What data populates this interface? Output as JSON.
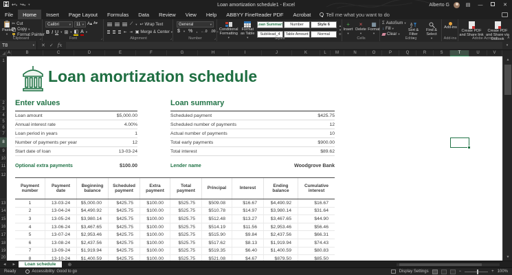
{
  "window": {
    "title": "Loan amortization schedule1  -  Excel",
    "user": "Alberto G"
  },
  "ribbon": {
    "tabs": [
      "File",
      "Home",
      "Insert",
      "Page Layout",
      "Formulas",
      "Data",
      "Review",
      "View",
      "Help",
      "ABBYY FineReader PDF",
      "Acrobat"
    ],
    "active_tab": "Home",
    "tell_me": "Tell me what you want to do",
    "clipboard": {
      "label": "Clipboard",
      "paste": "Paste",
      "cut": "Cut",
      "copy": "Copy",
      "format_painter": "Format Painter"
    },
    "font": {
      "label": "Font",
      "name": "Calibri",
      "size": "11"
    },
    "alignment": {
      "label": "Alignment",
      "wrap_text": "Wrap Text",
      "merge_center": "Merge & Center"
    },
    "number": {
      "label": "Number",
      "format": "General"
    },
    "styles": {
      "label": "Styles",
      "conditional": "Conditional Formatting",
      "format_table": "Format as Table",
      "gallery": [
        "Loan Summary",
        "Number",
        "Style 6",
        "SubHead_4",
        "Table Amount",
        "Normal"
      ]
    },
    "cells": {
      "label": "Cells",
      "buttons": [
        "Insert",
        "Delete",
        "Format"
      ]
    },
    "editing": {
      "label": "Editing",
      "autosum": "AutoSum",
      "fill": "Fill",
      "clear": "Clear",
      "sort": "Sort & Filter",
      "find": "Find & Select"
    },
    "addins": {
      "label": "Add-ins",
      "button": "Add-ins"
    },
    "acrobat": {
      "label": "Adobe Acrobat",
      "buttons": [
        "Create PDF and Share link",
        "Create PDF and Share via Outlook"
      ]
    }
  },
  "formula_bar": {
    "name_box": "T8"
  },
  "grid": {
    "columns": [
      "A",
      "B",
      "C",
      "D",
      "E",
      "F",
      "G",
      "H",
      "I",
      "J",
      "K",
      "L",
      "M",
      "N",
      "O",
      "P",
      "Q",
      "R",
      "S",
      "T",
      "U",
      "V"
    ],
    "selected_column": "T",
    "rows": [
      1,
      2,
      3,
      4,
      5,
      6,
      7,
      8,
      9,
      10,
      11,
      12,
      13,
      14,
      15,
      16,
      17,
      18,
      19,
      20
    ],
    "selected_row": 8
  },
  "sheet": {
    "title": "Loan amortization schedule",
    "enter_values": {
      "heading": "Enter values",
      "fields": [
        {
          "label": "Loan amount",
          "value": "$5,000.00"
        },
        {
          "label": "Annual interest rate",
          "value": "4.00%"
        },
        {
          "label": "Loan period in years",
          "value": "1"
        },
        {
          "label": "Number of payments per year",
          "value": "12"
        },
        {
          "label": "Start date of loan",
          "value": "13-03-24"
        }
      ],
      "extra_label": "Optional extra payments",
      "extra_value": "$100.00"
    },
    "loan_summary": {
      "heading": "Loan summary",
      "fields": [
        {
          "label": "Scheduled payment",
          "value": "$425.75"
        },
        {
          "label": "Scheduled number of payments",
          "value": "12"
        },
        {
          "label": "Actual number of payments",
          "value": "10"
        },
        {
          "label": "Total early payments",
          "value": "$900.00"
        },
        {
          "label": "Total interest",
          "value": "$89.62"
        }
      ],
      "lender_label": "Lender name",
      "lender_value": "Woodgrove Bank"
    },
    "table": {
      "headers": [
        "Payment number",
        "Payment date",
        "Beginning balance",
        "Scheduled payment",
        "Extra payment",
        "Total payment",
        "Principal",
        "Interest",
        "Ending balance",
        "Cumulative interest"
      ],
      "rows": [
        [
          "1",
          "13-03-24",
          "$5,000.00",
          "$425.75",
          "$100.00",
          "$525.75",
          "$509.08",
          "$16.67",
          "$4,490.92",
          "$16.67"
        ],
        [
          "2",
          "13-04-24",
          "$4,490.92",
          "$425.75",
          "$100.00",
          "$525.75",
          "$510.78",
          "$14.97",
          "$3,980.14",
          "$31.64"
        ],
        [
          "3",
          "13-05-24",
          "$3,980.14",
          "$425.75",
          "$100.00",
          "$525.75",
          "$512.48",
          "$13.27",
          "$3,467.65",
          "$44.90"
        ],
        [
          "4",
          "13-06-24",
          "$3,467.65",
          "$425.75",
          "$100.00",
          "$525.75",
          "$514.19",
          "$11.56",
          "$2,953.46",
          "$56.46"
        ],
        [
          "5",
          "13-07-24",
          "$2,953.46",
          "$425.75",
          "$100.00",
          "$525.75",
          "$515.90",
          "$9.84",
          "$2,437.56",
          "$66.31"
        ],
        [
          "6",
          "13-08-24",
          "$2,437.56",
          "$425.75",
          "$100.00",
          "$525.75",
          "$517.62",
          "$8.13",
          "$1,919.94",
          "$74.43"
        ],
        [
          "7",
          "13-09-24",
          "$1,919.94",
          "$425.75",
          "$100.00",
          "$525.75",
          "$519.35",
          "$6.40",
          "$1,400.59",
          "$80.83"
        ],
        [
          "8",
          "13-10-24",
          "$1,400.59",
          "$425.75",
          "$100.00",
          "$525.75",
          "$521.08",
          "$4.67",
          "$879.50",
          "$85.50"
        ]
      ]
    }
  },
  "tabs_bar": {
    "sheet": "Loan schedule"
  },
  "status_bar": {
    "ready": "Ready",
    "accessibility": "Accessibility: Good to go",
    "display_settings": "Display Settings",
    "zoom": "100%"
  },
  "colors": {
    "accent_green": "#217346",
    "title_green": "#1e6e41"
  }
}
